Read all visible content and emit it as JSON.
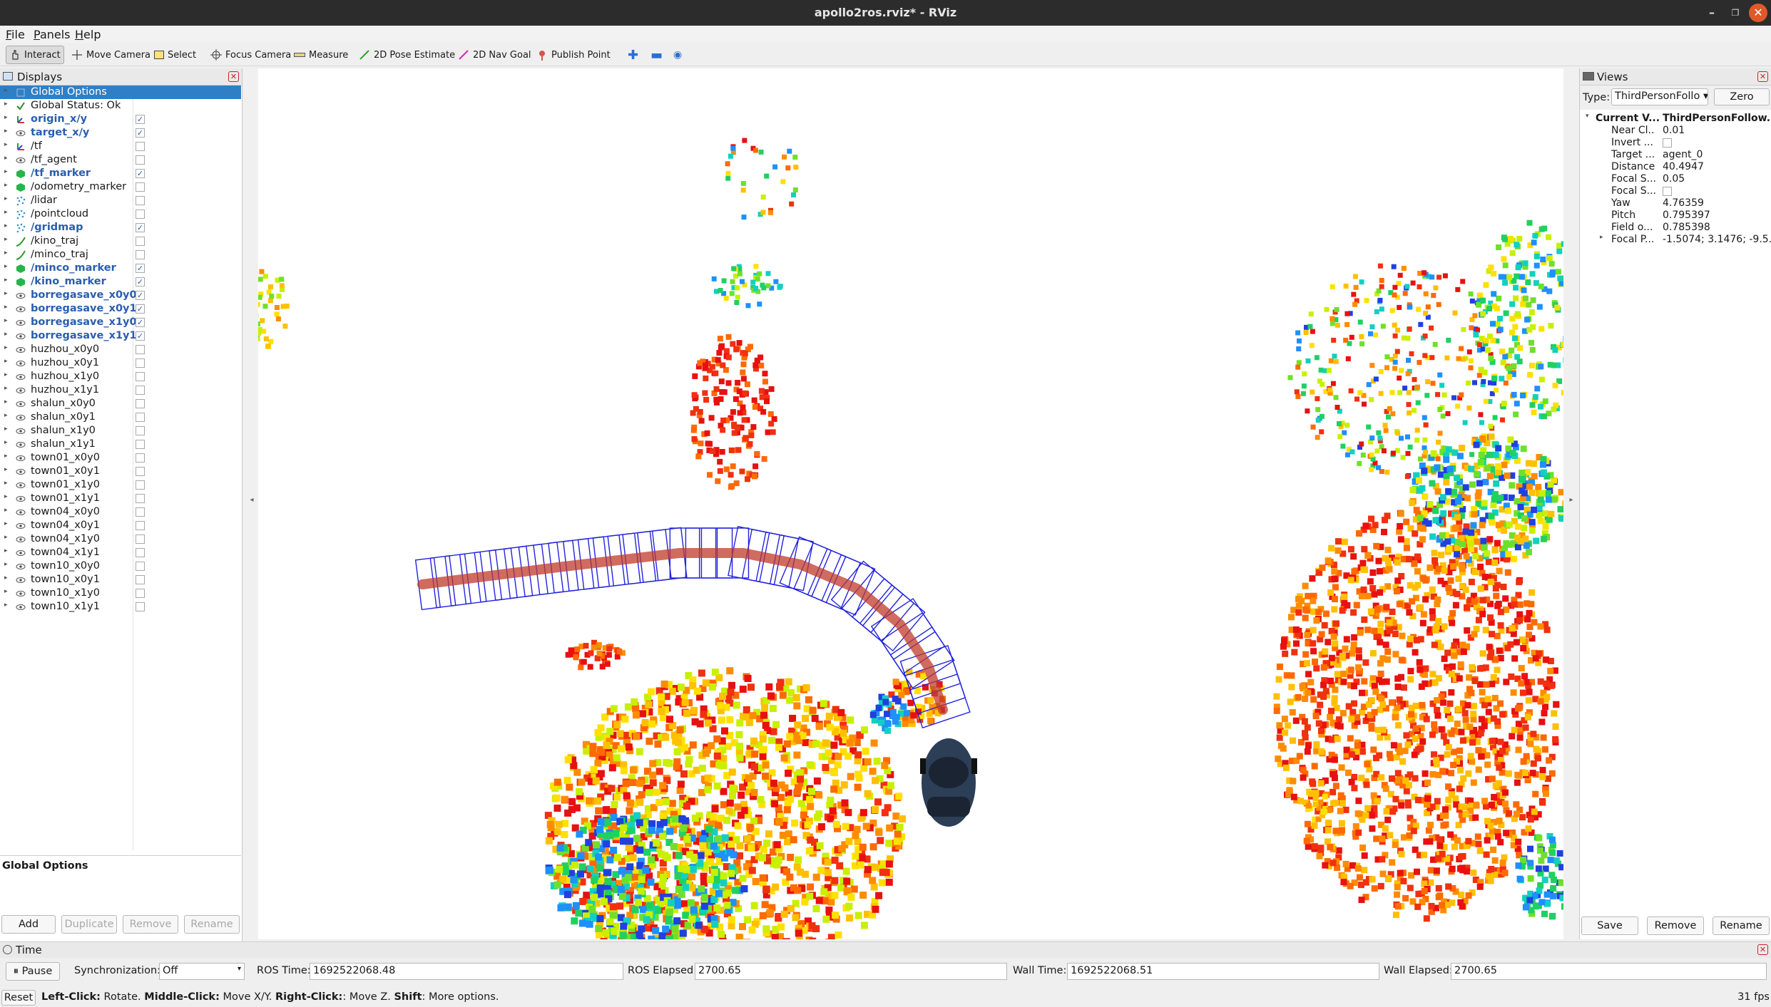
{
  "window": {
    "title": "apollo2ros.rviz* - RViz"
  },
  "menu": {
    "file": "File",
    "panels": "Panels",
    "help": "Help"
  },
  "toolbar": {
    "interact": "Interact",
    "move_camera": "Move Camera",
    "select": "Select",
    "focus_camera": "Focus Camera",
    "measure": "Measure",
    "pose_estimate": "2D Pose Estimate",
    "nav_goal": "2D Nav Goal",
    "publish_point": "Publish Point"
  },
  "displays": {
    "title": "Displays",
    "items": [
      {
        "label": "Global Options",
        "checked": null,
        "bold": false,
        "icon": "globe-icon"
      },
      {
        "label": "Global Status: Ok",
        "checked": null,
        "bold": false,
        "icon": "check-icon"
      },
      {
        "label": "origin_x/y",
        "checked": true,
        "bold": true,
        "icon": "axes-icon"
      },
      {
        "label": "target_x/y",
        "checked": true,
        "bold": true,
        "icon": "eye-icon"
      },
      {
        "label": "/tf",
        "checked": false,
        "bold": false,
        "icon": "axes-icon"
      },
      {
        "label": "/tf_agent",
        "checked": false,
        "bold": false,
        "icon": "eye-icon"
      },
      {
        "label": "/tf_marker",
        "checked": true,
        "bold": true,
        "icon": "marker-icon"
      },
      {
        "label": "/odometry_marker",
        "checked": false,
        "bold": false,
        "icon": "marker-icon"
      },
      {
        "label": "/lidar",
        "checked": false,
        "bold": false,
        "icon": "pointcloud-icon"
      },
      {
        "label": "/pointcloud",
        "checked": false,
        "bold": false,
        "icon": "pointcloud-icon"
      },
      {
        "label": "/gridmap",
        "checked": true,
        "bold": true,
        "icon": "pointcloud-icon"
      },
      {
        "label": "/kino_traj",
        "checked": false,
        "bold": false,
        "icon": "path-icon"
      },
      {
        "label": "/minco_traj",
        "checked": false,
        "bold": false,
        "icon": "path-icon"
      },
      {
        "label": "/minco_marker",
        "checked": true,
        "bold": true,
        "icon": "marker-icon"
      },
      {
        "label": "/kino_marker",
        "checked": true,
        "bold": true,
        "icon": "marker-icon"
      },
      {
        "label": "borregasave_x0y0",
        "checked": true,
        "bold": true,
        "icon": "eye-icon"
      },
      {
        "label": "borregasave_x0y1",
        "checked": true,
        "bold": true,
        "icon": "eye-icon"
      },
      {
        "label": "borregasave_x1y0",
        "checked": true,
        "bold": true,
        "icon": "eye-icon"
      },
      {
        "label": "borregasave_x1y1",
        "checked": true,
        "bold": true,
        "icon": "eye-icon"
      },
      {
        "label": "huzhou_x0y0",
        "checked": false,
        "bold": false,
        "icon": "eye-icon"
      },
      {
        "label": "huzhou_x0y1",
        "checked": false,
        "bold": false,
        "icon": "eye-icon"
      },
      {
        "label": "huzhou_x1y0",
        "checked": false,
        "bold": false,
        "icon": "eye-icon"
      },
      {
        "label": "huzhou_x1y1",
        "checked": false,
        "bold": false,
        "icon": "eye-icon"
      },
      {
        "label": "shalun_x0y0",
        "checked": false,
        "bold": false,
        "icon": "eye-icon"
      },
      {
        "label": "shalun_x0y1",
        "checked": false,
        "bold": false,
        "icon": "eye-icon"
      },
      {
        "label": "shalun_x1y0",
        "checked": false,
        "bold": false,
        "icon": "eye-icon"
      },
      {
        "label": "shalun_x1y1",
        "checked": false,
        "bold": false,
        "icon": "eye-icon"
      },
      {
        "label": "town01_x0y0",
        "checked": false,
        "bold": false,
        "icon": "eye-icon"
      },
      {
        "label": "town01_x0y1",
        "checked": false,
        "bold": false,
        "icon": "eye-icon"
      },
      {
        "label": "town01_x1y0",
        "checked": false,
        "bold": false,
        "icon": "eye-icon"
      },
      {
        "label": "town01_x1y1",
        "checked": false,
        "bold": false,
        "icon": "eye-icon"
      },
      {
        "label": "town04_x0y0",
        "checked": false,
        "bold": false,
        "icon": "eye-icon"
      },
      {
        "label": "town04_x0y1",
        "checked": false,
        "bold": false,
        "icon": "eye-icon"
      },
      {
        "label": "town04_x1y0",
        "checked": false,
        "bold": false,
        "icon": "eye-icon"
      },
      {
        "label": "town04_x1y1",
        "checked": false,
        "bold": false,
        "icon": "eye-icon"
      },
      {
        "label": "town10_x0y0",
        "checked": false,
        "bold": false,
        "icon": "eye-icon"
      },
      {
        "label": "town10_x0y1",
        "checked": false,
        "bold": false,
        "icon": "eye-icon"
      },
      {
        "label": "town10_x1y0",
        "checked": false,
        "bold": false,
        "icon": "eye-icon"
      },
      {
        "label": "town10_x1y1",
        "checked": false,
        "bold": false,
        "icon": "eye-icon"
      }
    ],
    "description_title": "Global Options",
    "buttons": {
      "add": "Add",
      "duplicate": "Duplicate",
      "remove": "Remove",
      "rename": "Rename"
    }
  },
  "views": {
    "title": "Views",
    "type_label": "Type:",
    "type_value": "ThirdPersonFollo",
    "zero": "Zero",
    "current_label": "Current V...",
    "current_value": "ThirdPersonFollow...",
    "props": [
      {
        "key": "Near Cl...",
        "value": "0.01"
      },
      {
        "key": "Invert ...",
        "value": ""
      },
      {
        "key": "Target ...",
        "value": "agent_0"
      },
      {
        "key": "Distance",
        "value": "40.4947"
      },
      {
        "key": "Focal S...",
        "value": "0.05"
      },
      {
        "key": "Focal S...",
        "value": ""
      },
      {
        "key": "Yaw",
        "value": "4.76359"
      },
      {
        "key": "Pitch",
        "value": "0.795397"
      },
      {
        "key": "Field o...",
        "value": "0.785398"
      },
      {
        "key": "Focal P...",
        "value": "-1.5074; 3.1476; -9.5..."
      }
    ],
    "buttons": {
      "save": "Save",
      "remove": "Remove",
      "rename": "Rename"
    }
  },
  "time": {
    "title": "Time",
    "pause": "Pause",
    "sync_label": "Synchronization:",
    "sync_value": "Off",
    "ros_time_label": "ROS Time:",
    "ros_time": "1692522068.48",
    "ros_elapsed_label": "ROS Elapsed:",
    "ros_elapsed": "2700.65",
    "wall_time_label": "Wall Time:",
    "wall_time": "1692522068.51",
    "wall_elapsed_label": "Wall Elapsed:",
    "wall_elapsed": "2700.65"
  },
  "statusbar": {
    "reset": "Reset",
    "left_click": "Left-Click:",
    "left_action": " Rotate. ",
    "middle_click": "Middle-Click:",
    "middle_action": " Move X/Y. ",
    "right_click": "Right-Click:",
    "right_action": ": Move Z. ",
    "shift": "Shift",
    "shift_action": ": More options.",
    "fps": "31 fps"
  },
  "colors": {
    "selection": "#2f7fc6",
    "trajectory_box": "#2222dd",
    "path": "#c0392b"
  }
}
